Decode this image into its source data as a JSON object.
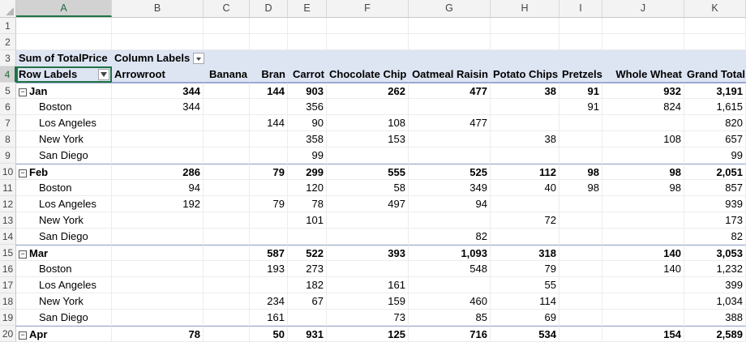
{
  "columns": [
    "A",
    "B",
    "C",
    "D",
    "E",
    "F",
    "G",
    "H",
    "I",
    "J",
    "K"
  ],
  "row_numbers": [
    "1",
    "2",
    "3",
    "4",
    "5",
    "6",
    "7",
    "8",
    "9",
    "10",
    "11",
    "12",
    "13",
    "14",
    "15",
    "16",
    "17",
    "18",
    "19",
    "20"
  ],
  "pivot": {
    "values_label": "Sum of TotalPrice",
    "column_labels": "Column Labels",
    "row_labels": "Row Labels",
    "headers": [
      "Arrowroot",
      "Banana",
      "Bran",
      "Carrot",
      "Chocolate Chip",
      "Oatmeal Raisin",
      "Potato Chips",
      "Pretzels",
      "Whole Wheat",
      "Grand Total"
    ],
    "rows": [
      {
        "label": "Jan",
        "type": "month",
        "values": [
          "344",
          "",
          "144",
          "903",
          "262",
          "477",
          "38",
          "91",
          "932",
          "3,191"
        ]
      },
      {
        "label": "Boston",
        "type": "city",
        "values": [
          "344",
          "",
          "",
          "356",
          "",
          "",
          "",
          "91",
          "824",
          "1,615"
        ]
      },
      {
        "label": "Los Angeles",
        "type": "city",
        "values": [
          "",
          "",
          "144",
          "90",
          "108",
          "477",
          "",
          "",
          "",
          "820"
        ]
      },
      {
        "label": "New York",
        "type": "city",
        "values": [
          "",
          "",
          "",
          "358",
          "153",
          "",
          "38",
          "",
          "108",
          "657"
        ]
      },
      {
        "label": "San Diego",
        "type": "city",
        "values": [
          "",
          "",
          "",
          "99",
          "",
          "",
          "",
          "",
          "",
          "99"
        ]
      },
      {
        "label": "Feb",
        "type": "month",
        "values": [
          "286",
          "",
          "79",
          "299",
          "555",
          "525",
          "112",
          "98",
          "98",
          "2,051"
        ]
      },
      {
        "label": "Boston",
        "type": "city",
        "values": [
          "94",
          "",
          "",
          "120",
          "58",
          "349",
          "40",
          "98",
          "98",
          "857"
        ]
      },
      {
        "label": "Los Angeles",
        "type": "city",
        "values": [
          "192",
          "",
          "79",
          "78",
          "497",
          "94",
          "",
          "",
          "",
          "939"
        ]
      },
      {
        "label": "New York",
        "type": "city",
        "values": [
          "",
          "",
          "",
          "101",
          "",
          "",
          "72",
          "",
          "",
          "173"
        ]
      },
      {
        "label": "San Diego",
        "type": "city",
        "values": [
          "",
          "",
          "",
          "",
          "",
          "82",
          "",
          "",
          "",
          "82"
        ]
      },
      {
        "label": "Mar",
        "type": "month",
        "values": [
          "",
          "",
          "587",
          "522",
          "393",
          "1,093",
          "318",
          "",
          "140",
          "3,053"
        ]
      },
      {
        "label": "Boston",
        "type": "city",
        "values": [
          "",
          "",
          "193",
          "273",
          "",
          "548",
          "79",
          "",
          "140",
          "1,232"
        ]
      },
      {
        "label": "Los Angeles",
        "type": "city",
        "values": [
          "",
          "",
          "",
          "182",
          "161",
          "",
          "55",
          "",
          "",
          "399"
        ]
      },
      {
        "label": "New York",
        "type": "city",
        "values": [
          "",
          "",
          "234",
          "67",
          "159",
          "460",
          "114",
          "",
          "",
          "1,034"
        ]
      },
      {
        "label": "San Diego",
        "type": "city",
        "values": [
          "",
          "",
          "161",
          "",
          "73",
          "85",
          "69",
          "",
          "",
          "388"
        ]
      },
      {
        "label": "Apr",
        "type": "month",
        "values": [
          "78",
          "",
          "50",
          "931",
          "125",
          "716",
          "534",
          "",
          "154",
          "2,589"
        ]
      }
    ]
  },
  "icons": {
    "filter": "dropdown-arrow-icon",
    "row_filter": "filter-funnel-icon",
    "collapse": "collapse-minus-icon"
  },
  "colors": {
    "header_fill": "#dde4f2",
    "selection_green": "#217346"
  }
}
